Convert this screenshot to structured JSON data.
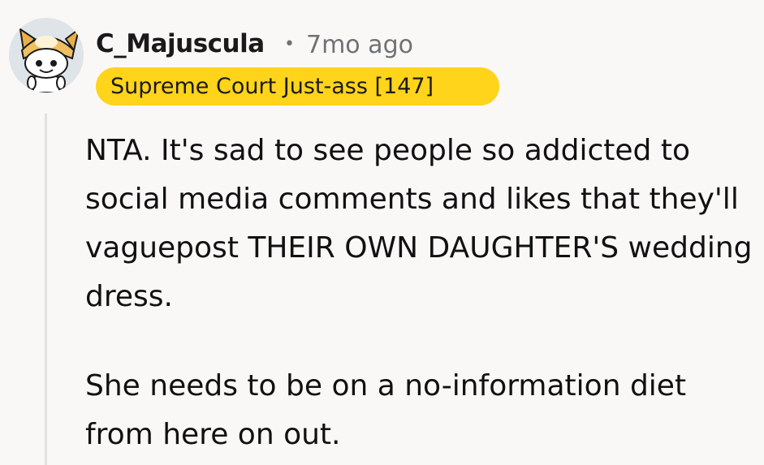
{
  "comment": {
    "author": "C_Majuscula",
    "separator": "•",
    "timestamp": "7mo ago",
    "flair": "Supreme Court Just-ass [147]",
    "paragraphs": [
      "NTA. It's sad to see people so addicted to social media comments and likes that they'll vaguepost THEIR OWN DAUGHTER'S wedding dress.",
      "She needs to be on a no-information diet from here on out."
    ]
  },
  "icons": {
    "avatar": "snoo-doge-avatar-icon"
  },
  "colors": {
    "background": "#faf8f6",
    "flair_background": "#ffd41a",
    "meta_text": "#6f7275",
    "thread_line": "#e3e1df"
  }
}
